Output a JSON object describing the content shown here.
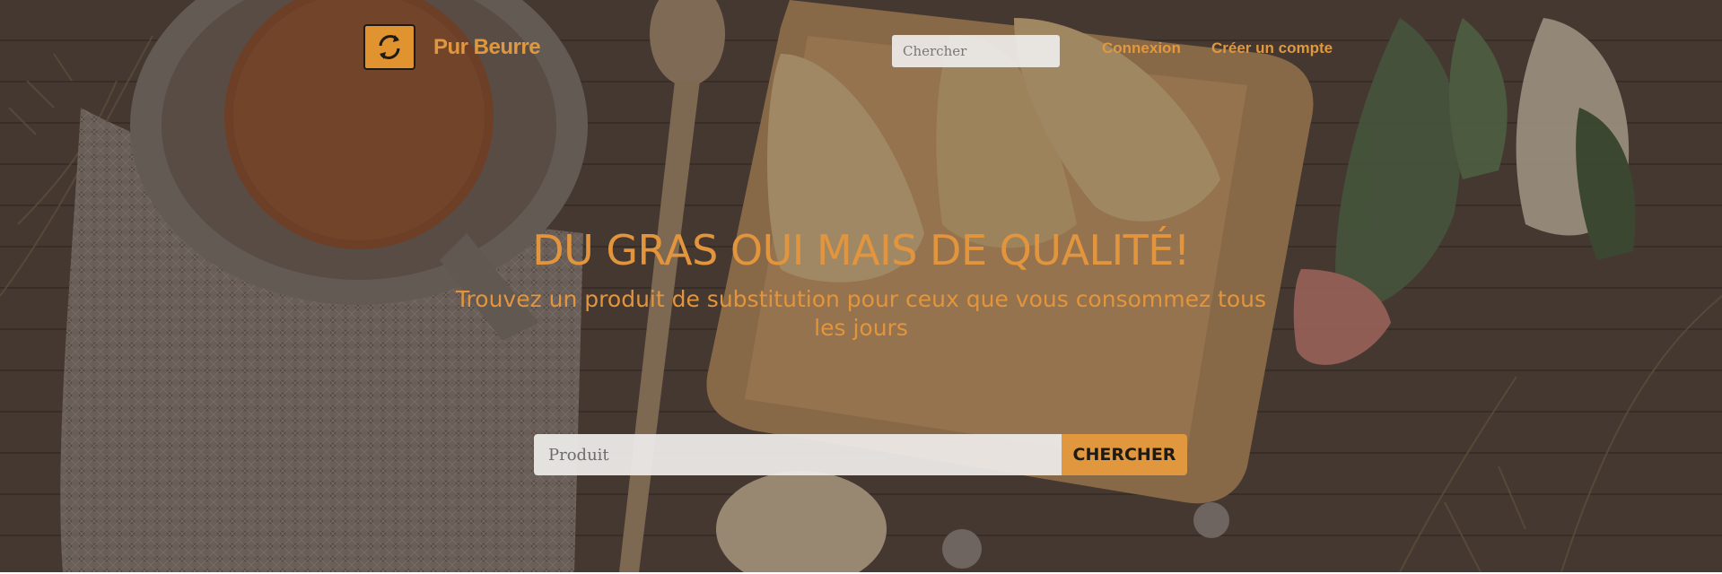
{
  "navbar": {
    "brand": "Pur Beurre",
    "logo_icon": "refresh-arrows-icon",
    "search": {
      "placeholder": "Chercher",
      "value": ""
    },
    "links": {
      "login": "Connexion",
      "signup": "Créer un compte"
    }
  },
  "hero": {
    "title": "DU GRAS OUI MAIS DE QUALITÉ!",
    "subtitle": "Trouvez un produit de substitution pour ceux que vous consommez tous les jours",
    "search": {
      "placeholder": "Produit",
      "value": ""
    },
    "search_button": "CHERCHER"
  },
  "colors": {
    "accent": "#e0973e",
    "background": "#4a3f38",
    "text_dark": "#1e1a16"
  }
}
